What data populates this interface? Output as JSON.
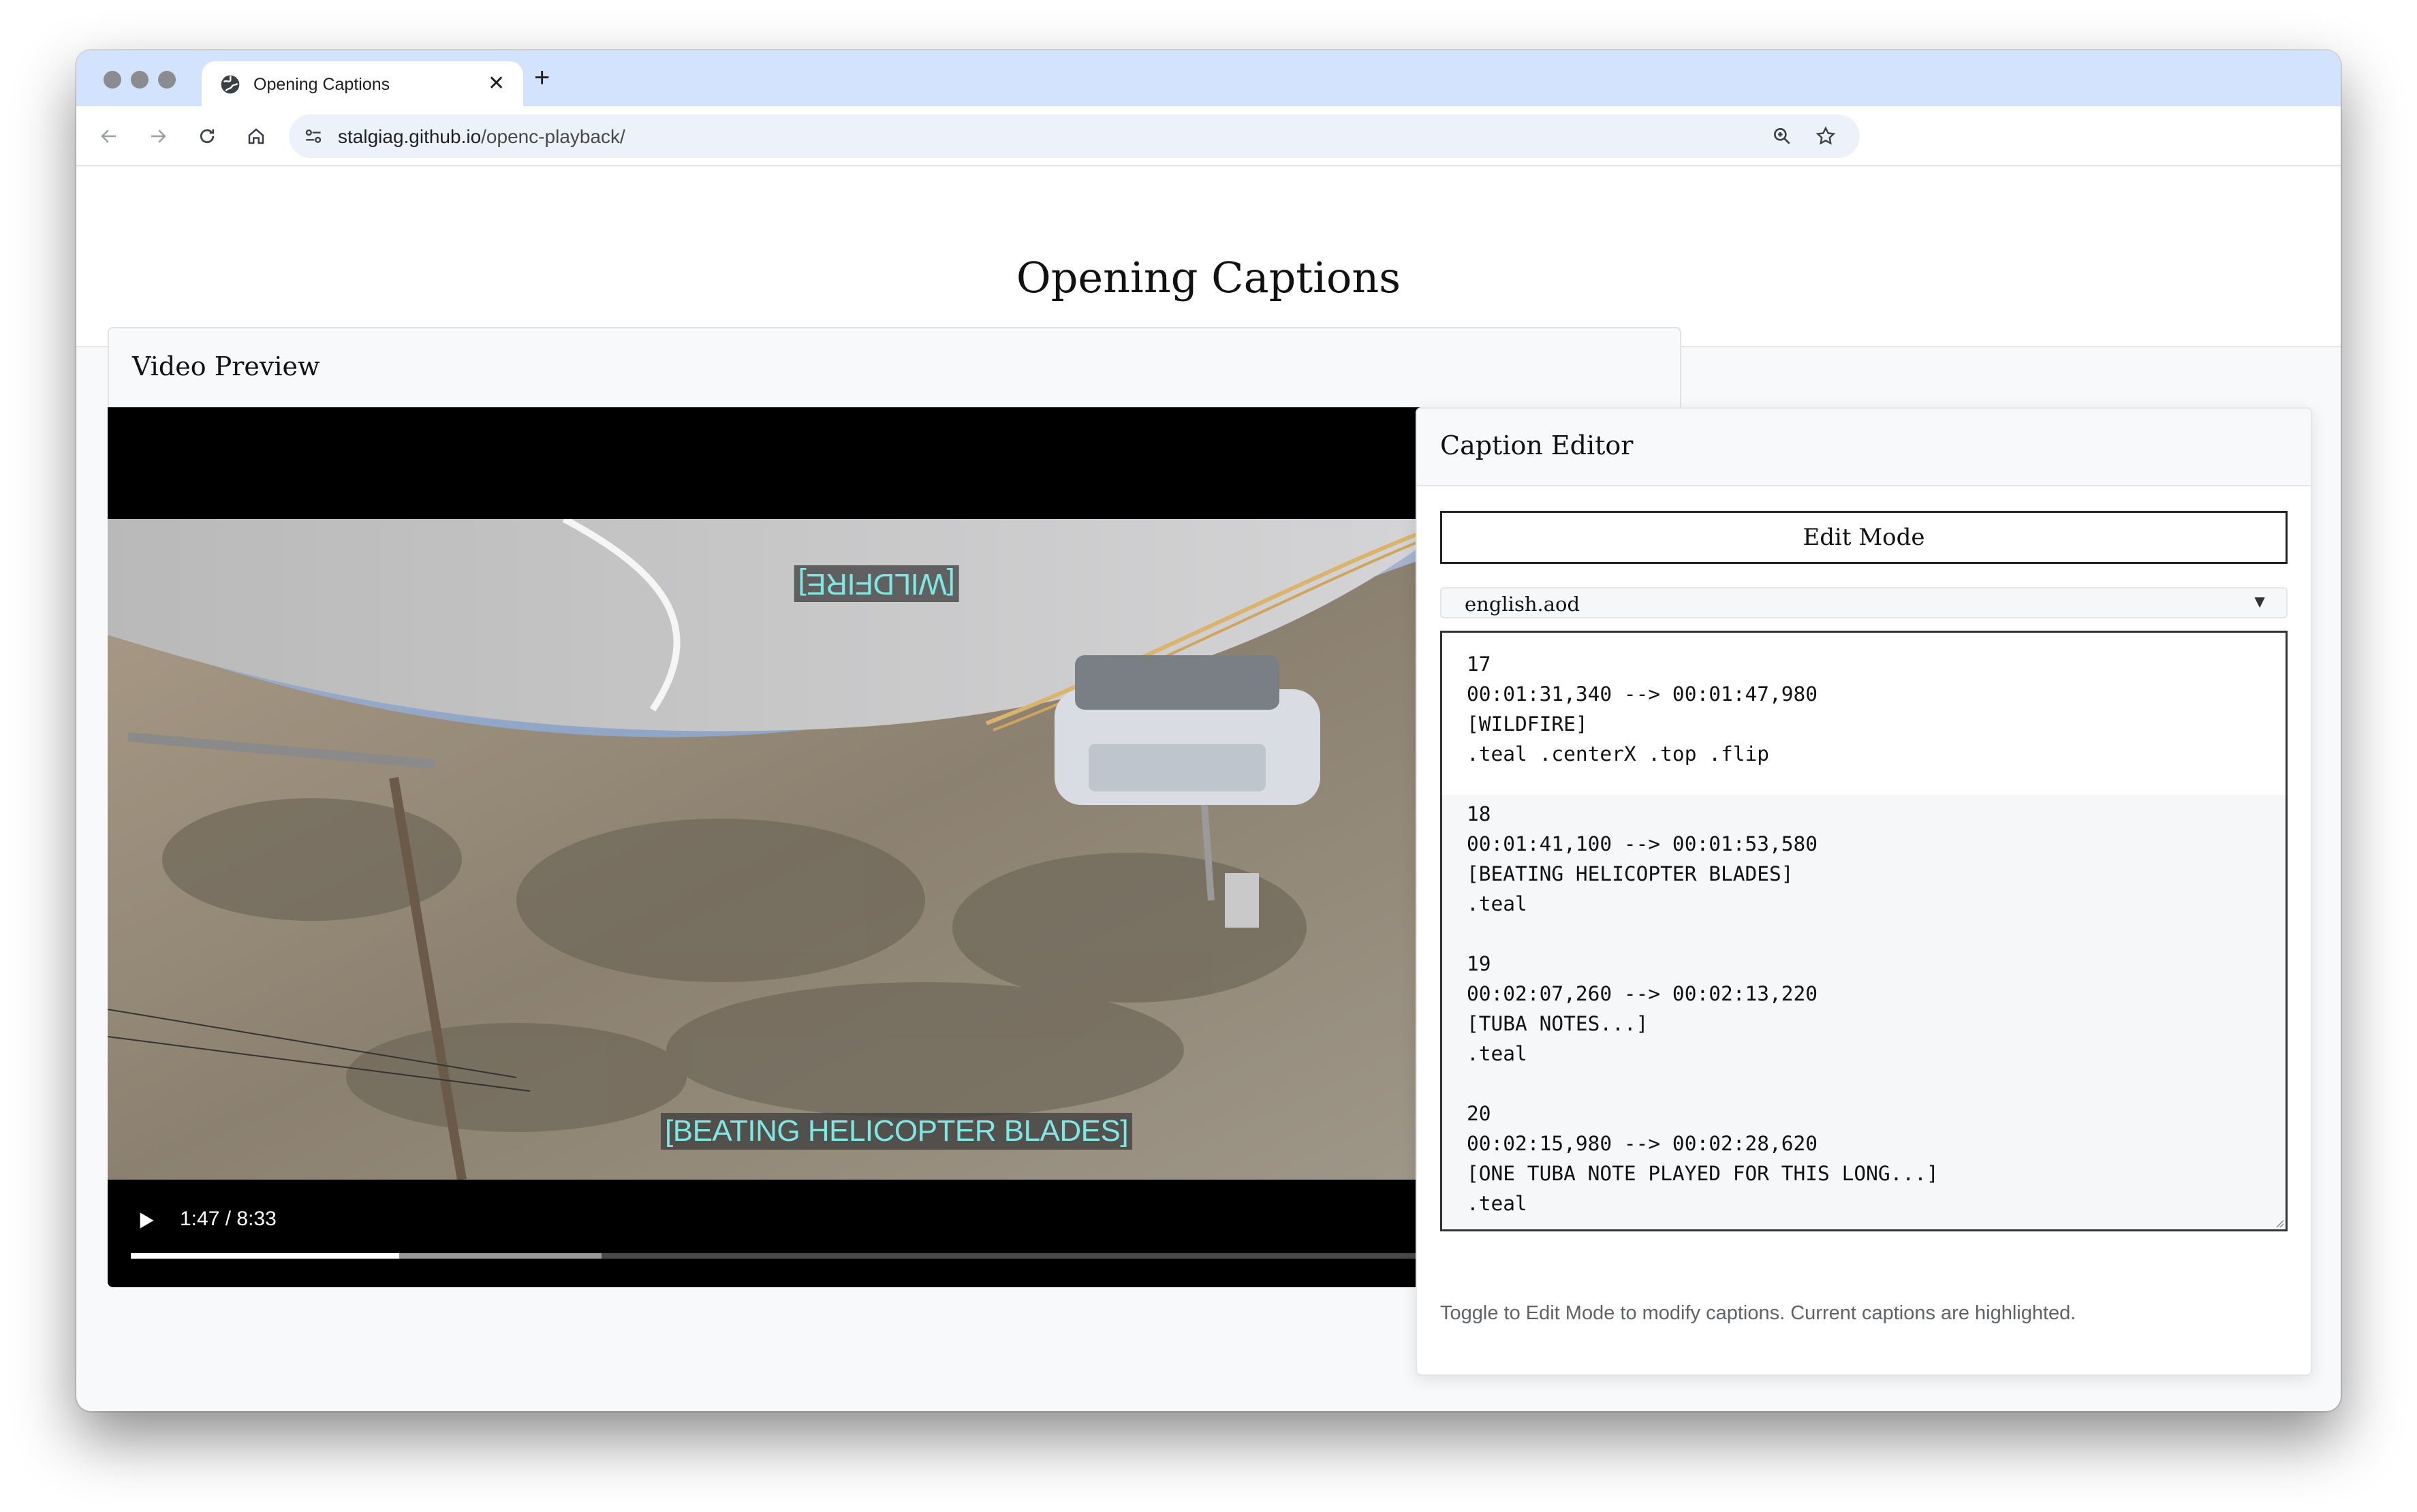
{
  "browser": {
    "tab_title": "Opening Captions",
    "url_host": "stalgiag.github.io",
    "url_path": "/openc-playback/"
  },
  "page": {
    "title": "Opening Captions"
  },
  "video_preview": {
    "title": "Video Preview",
    "captions": {
      "top": "[WILDFIRE]",
      "bottom": "[BEATING HELICOPTER BLADES]"
    },
    "timecode": "1:47 / 8:33",
    "progress_fraction": 0.208,
    "buffered_fraction": 0.365
  },
  "caption_editor": {
    "title": "Caption Editor",
    "mode_button": "Edit Mode",
    "selected_file": "english.aod",
    "cues": [
      {
        "index": "17",
        "timing": "00:01:31,340 --> 00:01:47,980",
        "text": "[WILDFIRE]",
        "classes": ".teal .centerX .top .flip",
        "highlighted": true
      },
      {
        "index": "18",
        "timing": "00:01:41,100 --> 00:01:53,580",
        "text": "[BEATING HELICOPTER BLADES]",
        "classes": ".teal",
        "highlighted": false
      },
      {
        "index": "19",
        "timing": "00:02:07,260 --> 00:02:13,220",
        "text": "[TUBA NOTES...]",
        "classes": ".teal",
        "highlighted": false
      },
      {
        "index": "20",
        "timing": "00:02:15,980 --> 00:02:28,620",
        "text": "[ONE TUBA NOTE PLAYED FOR THIS LONG...]",
        "classes": ".teal",
        "highlighted": false
      }
    ],
    "hint": "Toggle to Edit Mode to modify captions. Current captions are highlighted."
  }
}
